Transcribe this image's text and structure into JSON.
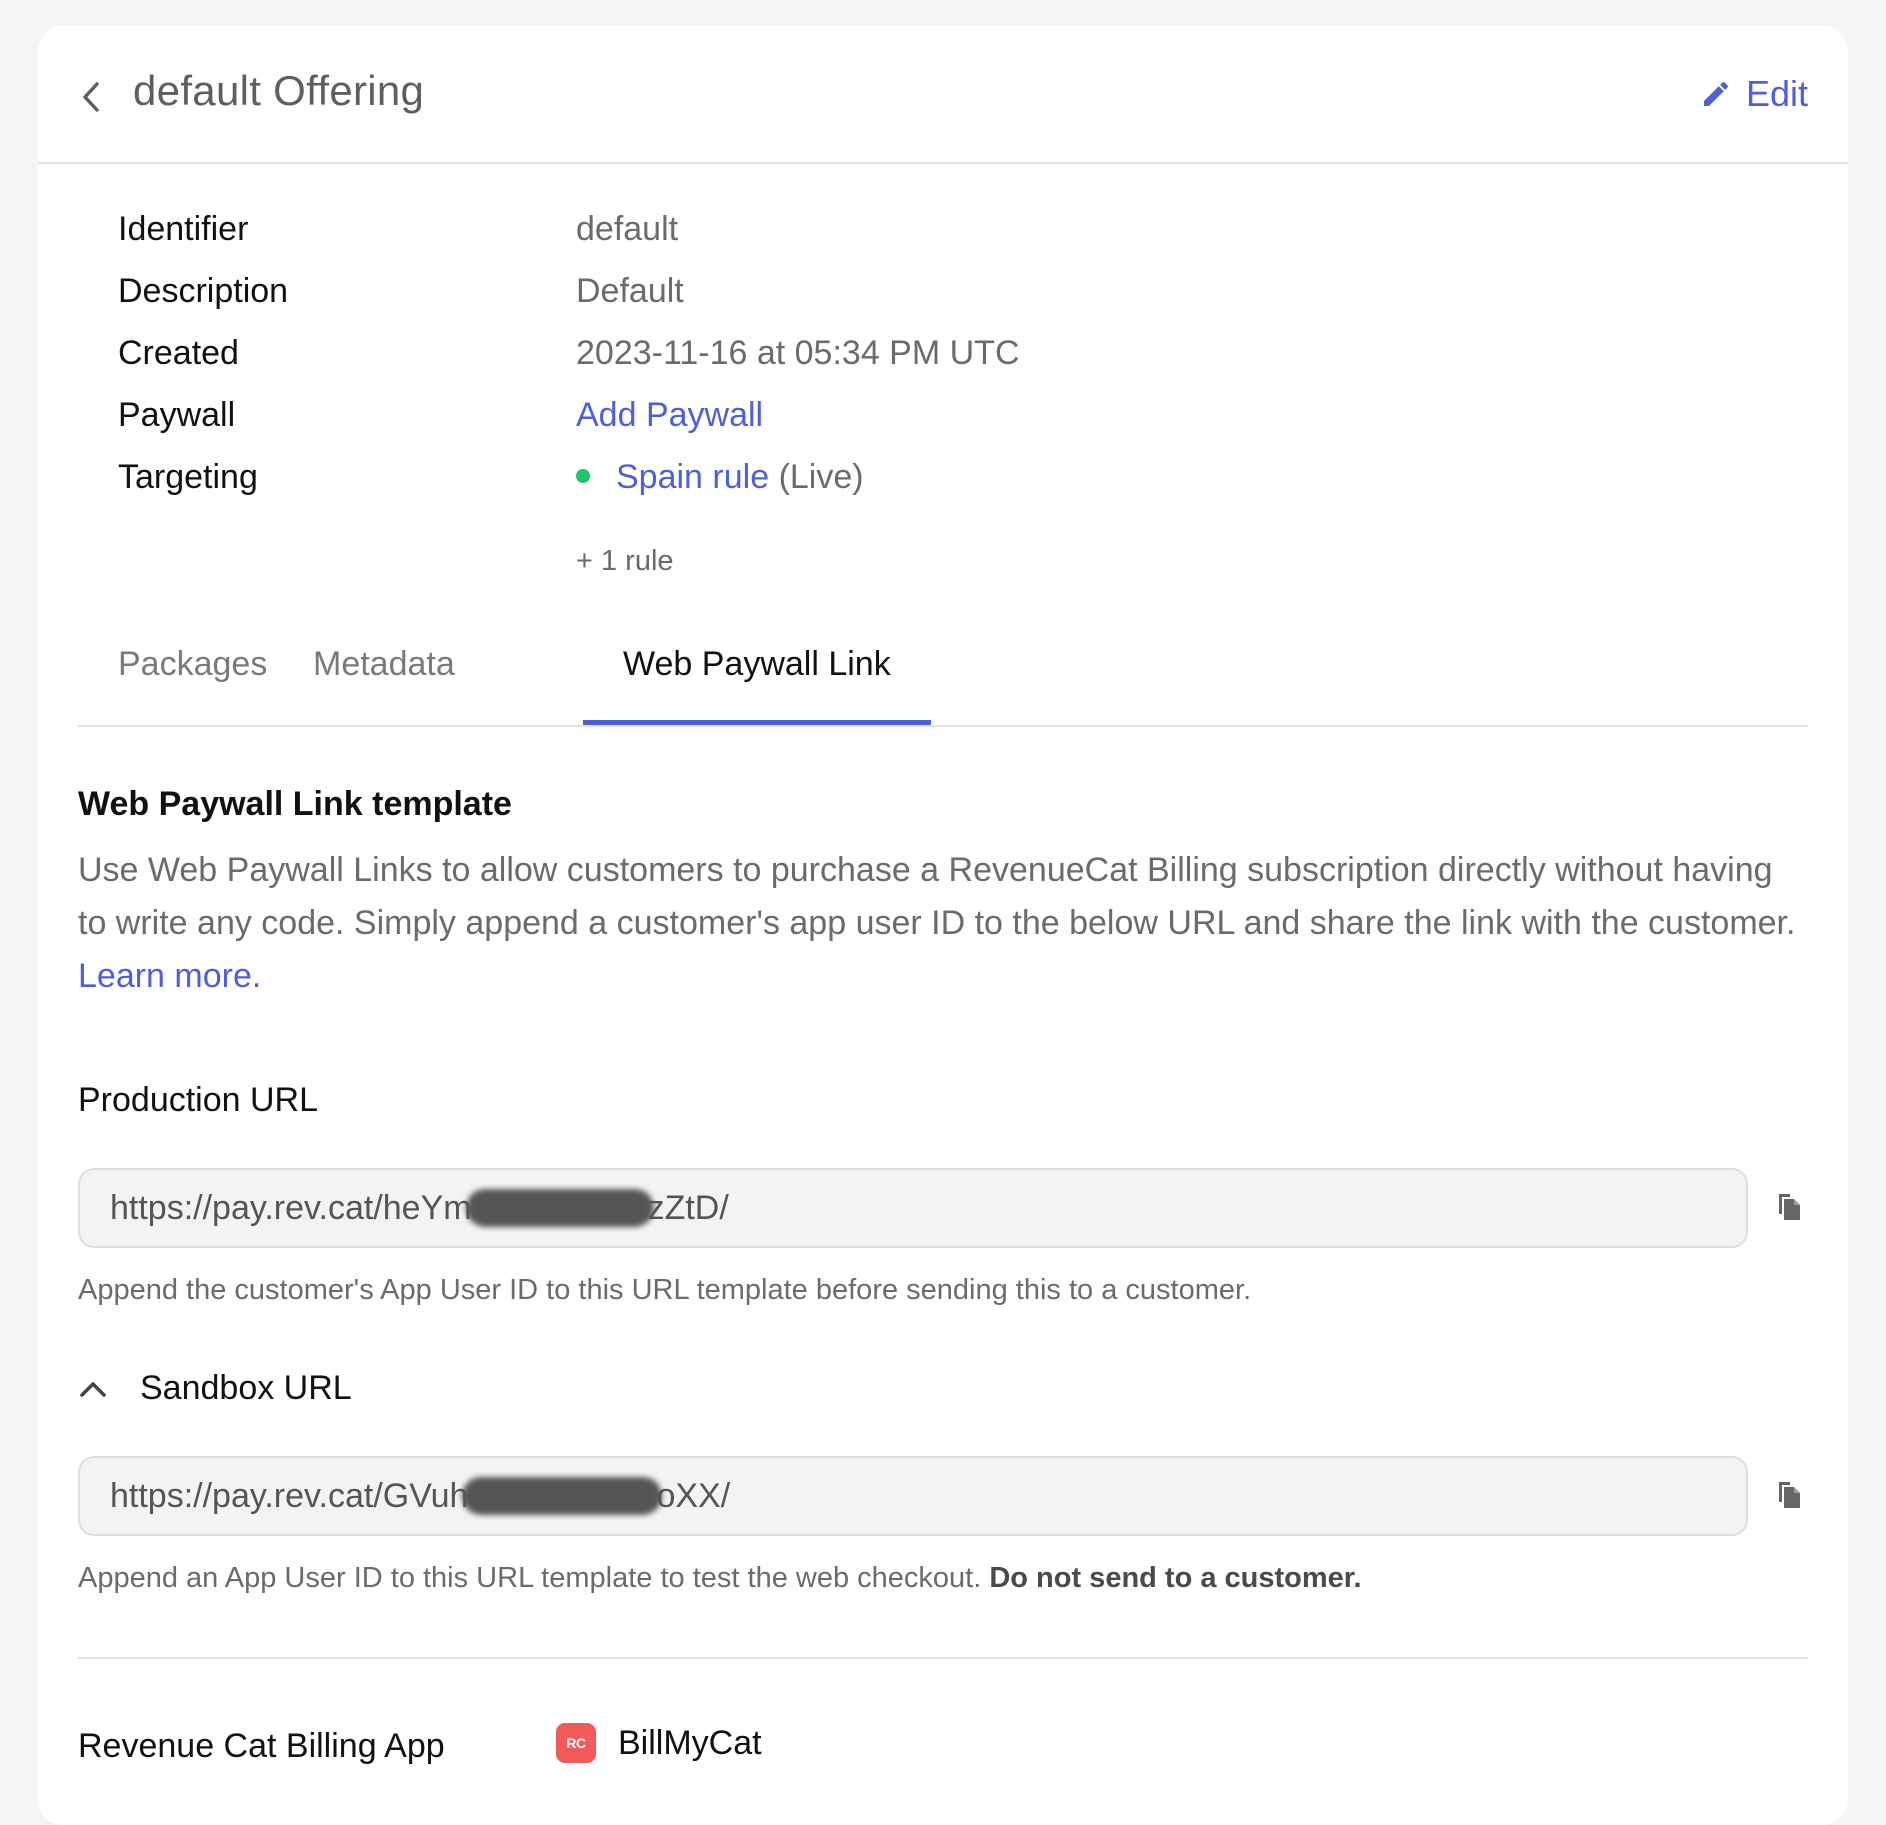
{
  "header": {
    "title": "default Offering",
    "edit_label": "Edit"
  },
  "details": {
    "identifier": {
      "label": "Identifier",
      "value": "default"
    },
    "description": {
      "label": "Description",
      "value": "Default"
    },
    "created": {
      "label": "Created",
      "value": "2023-11-16 at 05:34 PM UTC"
    },
    "paywall": {
      "label": "Paywall",
      "value": "Add Paywall"
    },
    "targeting": {
      "label": "Targeting",
      "rule_name": "Spain rule",
      "rule_status": "(Live)",
      "status_color": "#1ec36b",
      "extra": "+ 1 rule"
    }
  },
  "tabs": [
    {
      "label": "Packages",
      "active": false
    },
    {
      "label": "Metadata",
      "active": false
    },
    {
      "label": "Web Paywall Link",
      "active": true
    }
  ],
  "web_paywall": {
    "title": "Web Paywall Link template",
    "description": "Use Web Paywall Links to allow customers to purchase a RevenueCat Billing subscription directly without having to write any code. Simply append a customer's app user ID to the below URL and share the link with the customer. ",
    "learn_more": "Learn more.",
    "production": {
      "label": "Production URL",
      "url_prefix": "https://pay.rev.cat/heYm",
      "url_suffix": "zZtD/",
      "hint": "Append the customer's App User ID to this URL template before sending this to a customer."
    },
    "sandbox": {
      "label": "Sandbox URL",
      "url_prefix": "https://pay.rev.cat/GVuh",
      "url_suffix": "oXX/",
      "hint": "Append an App User ID to this URL template to test the web checkout. ",
      "hint_bold": "Do not send to a customer."
    },
    "billing": {
      "label": "Revenue Cat Billing App",
      "app_name": "BillMyCat",
      "app_logo_text": "RC"
    }
  },
  "colors": {
    "accent": "#4f5fd6",
    "status_live": "#1ec36b",
    "app_logo": "#f25a5a"
  }
}
